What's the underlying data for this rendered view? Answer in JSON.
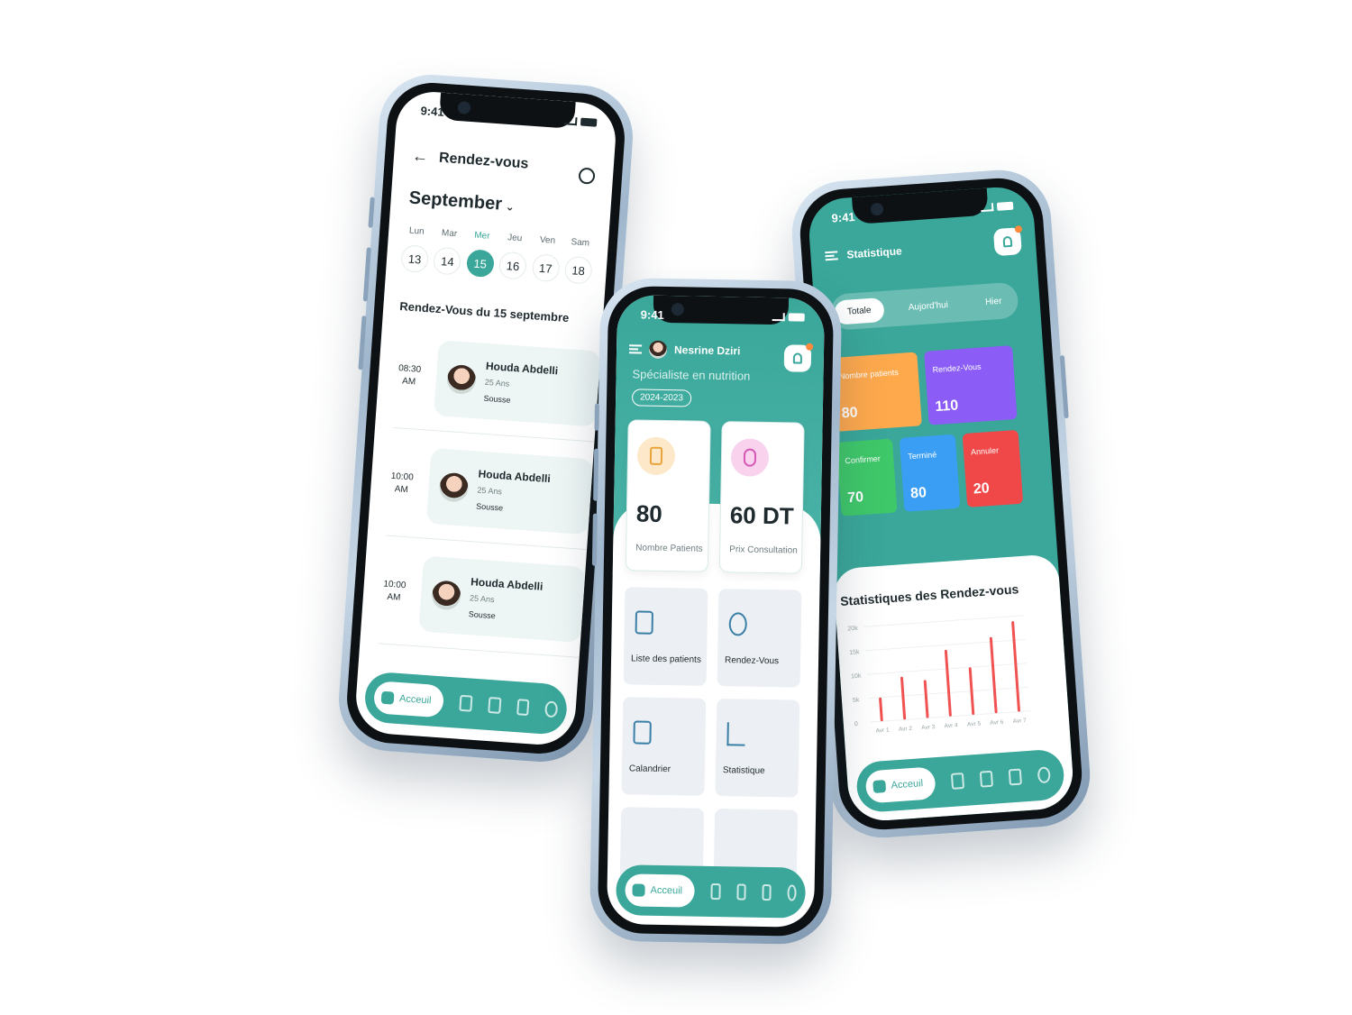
{
  "status": {
    "time": "9:41"
  },
  "phone1": {
    "title": "Rendez-vous",
    "month": "September",
    "week": [
      {
        "name": "Lun",
        "num": "13"
      },
      {
        "name": "Mar",
        "num": "14"
      },
      {
        "name": "Mer",
        "num": "15"
      },
      {
        "name": "Jeu",
        "num": "16"
      },
      {
        "name": "Ven",
        "num": "17"
      },
      {
        "name": "Sam",
        "num": "18"
      }
    ],
    "selected_day": "15",
    "section_title": "Rendez-Vous du 15 septembre",
    "appointments": [
      {
        "time_hm": "08:30",
        "time_ap": "AM",
        "name": "Houda Abdelli",
        "age": "25 Ans",
        "city": "Sousse"
      },
      {
        "time_hm": "10:00",
        "time_ap": "AM",
        "name": "Houda Abdelli",
        "age": "25 Ans",
        "city": "Sousse"
      },
      {
        "time_hm": "10:00",
        "time_ap": "AM",
        "name": "Houda Abdelli",
        "age": "25 Ans",
        "city": "Sousse"
      }
    ],
    "nav_home": "Acceuil"
  },
  "phone2": {
    "user_name": "Nesrine Dziri",
    "specialty": "Spécialiste en nutrition",
    "year": "2024-2023",
    "cards": [
      {
        "value": "80",
        "label": "Nombre Patients"
      },
      {
        "value": "60 DT",
        "label": "Prix Consultation"
      }
    ],
    "tiles": [
      "Liste des patients",
      "Rendez-Vous",
      "Calandrier",
      "Statistique"
    ],
    "nav_home": "Acceuil"
  },
  "phone3": {
    "title": "Statistique",
    "tabs": [
      "Totale",
      "Aujord'hui",
      "Hier"
    ],
    "active_tab": "Totale",
    "kpis": [
      {
        "label": "Nombre patients",
        "value": "80",
        "color": "#ffa94d"
      },
      {
        "label": "Rendez-Vous",
        "value": "110",
        "color": "#8b5cf6"
      },
      {
        "label": "Confirmer",
        "value": "70",
        "color": "#3fc86a"
      },
      {
        "label": "Terminé",
        "value": "80",
        "color": "#3b9ef5"
      },
      {
        "label": "Annuler",
        "value": "20",
        "color": "#f04848"
      }
    ],
    "chart_title": "Statistiques des Rendez-vous",
    "nav_home": "Acceuil"
  },
  "colors": {
    "teal": "#3aa79a",
    "bar": "#f05252"
  },
  "chart_data": {
    "type": "bar",
    "title": "Statistiques des Rendez-vous",
    "categories": [
      "Avr 1",
      "Avr 2",
      "Avr 3",
      "Avr 4",
      "Avr 5",
      "Avr 6",
      "Avr 7"
    ],
    "values": [
      5000,
      9000,
      8000,
      14000,
      10000,
      16000,
      19000
    ],
    "y_ticks": [
      "0",
      "5k",
      "10k",
      "15k",
      "20k"
    ],
    "ylim": [
      0,
      20000
    ],
    "grid": true
  }
}
